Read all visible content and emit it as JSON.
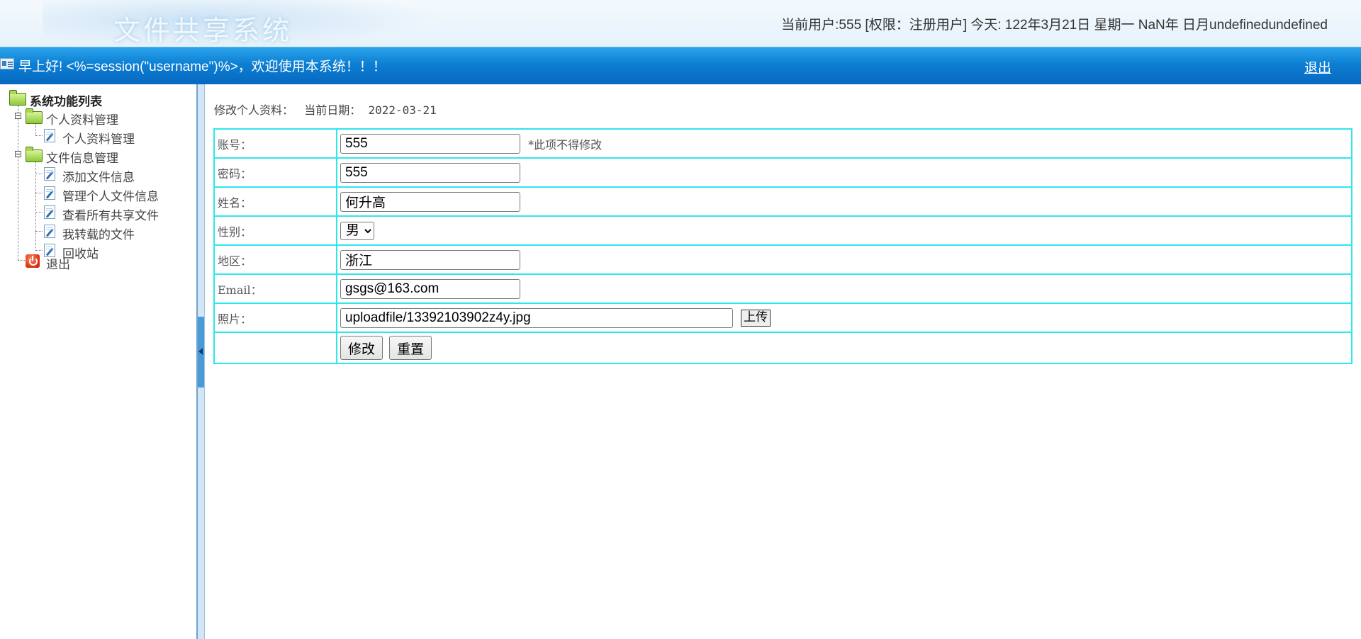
{
  "header": {
    "logo_text": "文件共享系统",
    "user_info": "当前用户:555 [权限：注册用户] 今天:   122年3月21日 星期一 NaN年 日月undefinedundefined",
    "greeting": "早上好! <%=session(\"username\")%>，欢迎使用本系统！！！",
    "logout_label": "退出"
  },
  "sidebar": {
    "root_label": "系统功能列表",
    "groups": [
      {
        "label": "个人资料管理",
        "items": [
          "个人资料管理"
        ]
      },
      {
        "label": "文件信息管理",
        "items": [
          "添加文件信息",
          "管理个人文件信息",
          "查看所有共享文件",
          "我转载的文件",
          "回收站"
        ]
      }
    ],
    "exit_label": "退出"
  },
  "main": {
    "title": "修改个人资料：",
    "date_label": "当前日期：",
    "date_value": "2022-03-21",
    "form": {
      "account_label": "账号：",
      "account_value": "555",
      "account_note": "*此项不得修改",
      "password_label": "密码：",
      "password_value": "555",
      "name_label": "姓名：",
      "name_value": "何升高",
      "gender_label": "性别：",
      "gender_value": "男",
      "region_label": "地区：",
      "region_value": "浙江",
      "email_label": "Email：",
      "email_value": "gsgs@163.com",
      "photo_label": "照片：",
      "photo_value": "uploadfile/13392103902z4y.jpg",
      "upload_label": "上传",
      "submit_label": "修改",
      "reset_label": "重置"
    }
  },
  "colors": {
    "header_bar": "#0c7fd3",
    "table_border": "#2ee6ee",
    "sidebar_border": "#6fa3cf"
  }
}
